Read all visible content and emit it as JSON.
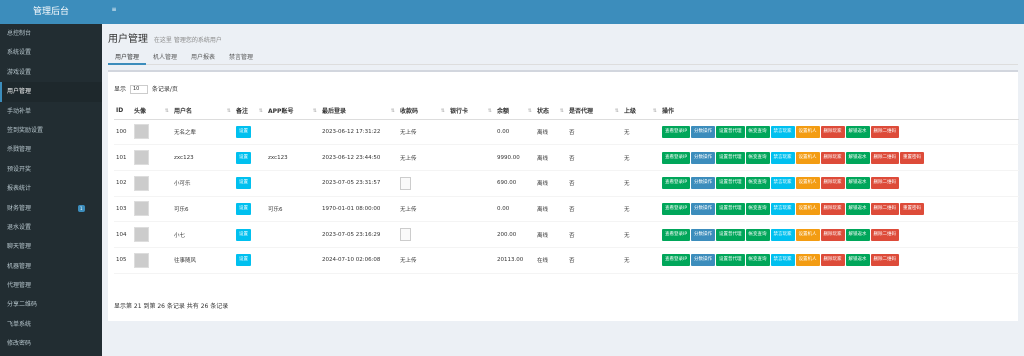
{
  "app": {
    "brand": "管理后台"
  },
  "sidebar": {
    "items": [
      {
        "label": "总控制台"
      },
      {
        "label": "系统设置"
      },
      {
        "label": "游戏设置"
      },
      {
        "label": "用户管理"
      },
      {
        "label": "手动补单"
      },
      {
        "label": "签到奖励设置"
      },
      {
        "label": "杀戮管理"
      },
      {
        "label": "预设开奖"
      },
      {
        "label": "报表统计"
      },
      {
        "label": "财务管理",
        "badge": "1"
      },
      {
        "label": "退水设置"
      },
      {
        "label": "聊天管理"
      },
      {
        "label": "机器管理"
      },
      {
        "label": "代理管理"
      },
      {
        "label": "分享二维码"
      },
      {
        "label": "飞单系统"
      },
      {
        "label": "修改密码"
      }
    ]
  },
  "page": {
    "title": "用户管理",
    "subtitle": "在这里 管理您的系统用户",
    "tabs": [
      "用户管理",
      "机人管理",
      "用户报表",
      "禁言管理"
    ],
    "length_prefix": "显示",
    "length_value": "10",
    "length_suffix": "条记录/页",
    "footer": "显示第 21 到第 26 条记录 共有 26 条记录"
  },
  "table": {
    "headers": [
      "ID",
      "头像",
      "用户名",
      "备注",
      "APP账号",
      "最后登录",
      "收款码",
      "银行卡",
      "余额",
      "状态",
      "是否代理",
      "上级",
      "操作"
    ],
    "rows": [
      {
        "id": "100",
        "username": "无名之辈",
        "note": "设置",
        "app": "",
        "login": "2023-06-12 17:31:22",
        "qr": "无上传",
        "bank": "",
        "balance": "0.00",
        "status": "离线",
        "agent": "否",
        "parent": "无"
      },
      {
        "id": "101",
        "username": "zxc123",
        "note": "设置",
        "app": "zxc123",
        "login": "2023-06-12 23:44:50",
        "qr": "无上传",
        "bank": "",
        "balance": "9990.00",
        "status": "离线",
        "agent": "否",
        "parent": "无"
      },
      {
        "id": "102",
        "username": "小可乐",
        "note": "设置",
        "app": "",
        "login": "2023-07-05 23:31:57",
        "qr": "",
        "bank": "",
        "balance": "690.00",
        "status": "离线",
        "agent": "否",
        "parent": "无"
      },
      {
        "id": "103",
        "username": "可乐6",
        "note": "设置",
        "app": "可乐6",
        "login": "1970-01-01 08:00:00",
        "qr": "无上传",
        "bank": "",
        "balance": "0.00",
        "status": "离线",
        "agent": "否",
        "parent": "无"
      },
      {
        "id": "104",
        "username": "小七",
        "note": "设置",
        "app": "",
        "login": "2023-07-05 23:16:29",
        "qr": "",
        "bank": "",
        "balance": "200.00",
        "status": "离线",
        "agent": "否",
        "parent": "无"
      },
      {
        "id": "105",
        "username": "往事随风",
        "note": "设置",
        "app": "",
        "login": "2024-07-10 02:06:08",
        "qr": "无上传",
        "bank": "",
        "balance": "20113.00",
        "status": "在线",
        "agent": "否",
        "parent": "无"
      }
    ],
    "actions": {
      "view_ip": "查看登录IP",
      "score_op": "分数操作",
      "set_agent": "设置普代理",
      "account_query": "帐变查询",
      "ban_player": "禁言玩家",
      "set_robot": "设置机人",
      "delete_player": "删除玩家",
      "unbind_water": "解锁返水",
      "delete_qr": "删除二维码",
      "reset_password": "重置密码"
    },
    "action_colors": {
      "view_ip": "#00a65a",
      "score_op": "#3c8dbc",
      "set_agent": "#00a65a",
      "account_query": "#00a65a",
      "ban_player": "#00c0ef",
      "set_robot": "#f39c12",
      "delete_player": "#dd4b39",
      "unbind_water": "#00a65a",
      "delete_qr": "#dd4b39",
      "reset_password": "#dd4b39"
    }
  }
}
